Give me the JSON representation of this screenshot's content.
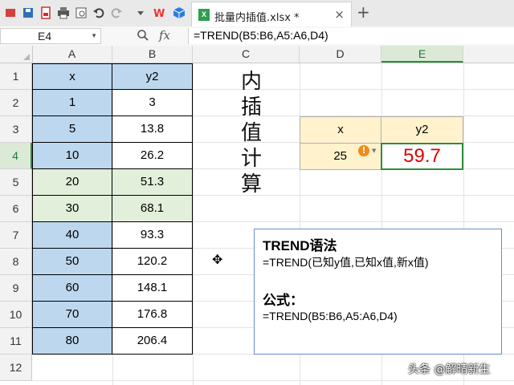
{
  "tab": {
    "filename": "批量内插值.xlsx *",
    "file_badge": "X",
    "close": "×",
    "new_tab": "+"
  },
  "toolbar_icons": [
    "wps-menu-icon",
    "save-icon",
    "pdf-export-icon",
    "print-icon",
    "print-preview-icon",
    "undo-icon",
    "redo-icon",
    "more-dropdown-icon",
    "wps-logo-icon",
    "cube-icon"
  ],
  "formula_bar": {
    "cell_ref": "E4",
    "fx_label": "fx",
    "formula": "=TREND(B5:B6,A5:A6,D4)"
  },
  "columns": [
    "A",
    "B",
    "C",
    "D",
    "E"
  ],
  "active_column": "E",
  "rows": [
    "1",
    "2",
    "3",
    "4",
    "5",
    "6",
    "7",
    "8",
    "9",
    "10",
    "11",
    "12"
  ],
  "active_row": "4",
  "table": {
    "headers": [
      "x",
      "y2"
    ],
    "data": [
      [
        "1",
        "3"
      ],
      [
        "5",
        "13.8"
      ],
      [
        "10",
        "26.2"
      ],
      [
        "20",
        "51.3"
      ],
      [
        "30",
        "68.1"
      ],
      [
        "40",
        "93.3"
      ],
      [
        "50",
        "120.2"
      ],
      [
        "60",
        "148.1"
      ],
      [
        "70",
        "176.8"
      ],
      [
        "80",
        "206.4"
      ]
    ]
  },
  "vertical_title": [
    "内",
    "插",
    "值",
    "计",
    "算"
  ],
  "result_table": {
    "x_header": "x",
    "y_header": "y2",
    "x_value": "25",
    "y_value": "59.7"
  },
  "warning_badge": "!",
  "info_box": {
    "title1": "TREND语法",
    "line1": "=TREND(已知y值,已知x值,新x值)",
    "title2": "公式：",
    "line2": "=TREND(B5:B6,A5:A6,D4)"
  },
  "watermark": "头条 @解晴新生",
  "colors": {
    "blue_fill": "#bdd7ee",
    "green_fill": "#e2efda",
    "yellow_fill": "#fff2cc",
    "result_red": "#e00000",
    "active_green": "#2e8b3d"
  }
}
